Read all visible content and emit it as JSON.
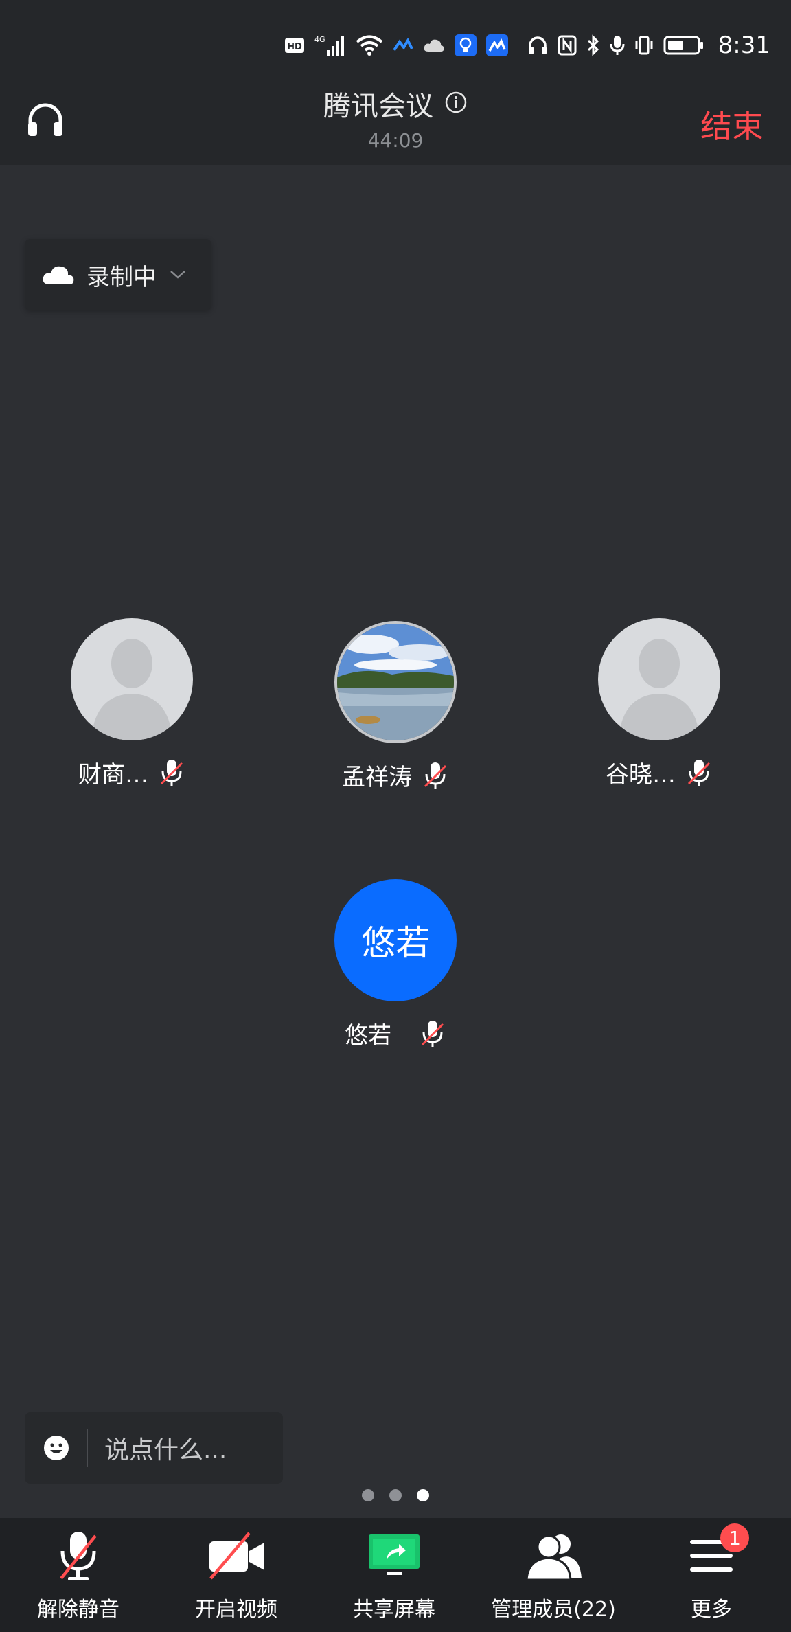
{
  "status_bar": {
    "icons": [
      "hd-icon",
      "4g-signal-icon",
      "wifi-icon",
      "app-icon",
      "cloud-icon",
      "bulb-icon",
      "app-icon",
      "headphone-icon",
      "nfc-icon",
      "bluetooth-icon",
      "mic-icon",
      "vibrate-icon",
      "battery-icon"
    ],
    "time": "8:31"
  },
  "header": {
    "title": "腾讯会议",
    "timer": "44:09",
    "end_label": "结束",
    "end_color": "#ff4a4f"
  },
  "recording": {
    "label": "录制中"
  },
  "participants": [
    {
      "name": "财商…",
      "avatar": "default",
      "muted": true
    },
    {
      "name": "孟祥涛",
      "avatar": "photo",
      "muted": true
    },
    {
      "name": "谷晓…",
      "avatar": "default",
      "muted": true
    },
    {
      "name": "悠若",
      "avatar": "text",
      "avatar_text": "悠若",
      "avatar_color": "#0a6cff",
      "muted": true
    }
  ],
  "chat": {
    "placeholder": "说点什么..."
  },
  "pager": {
    "total": 3,
    "active": 3
  },
  "toolbar": {
    "items": [
      {
        "label": "解除静音",
        "icon": "mic-muted-icon"
      },
      {
        "label": "开启视频",
        "icon": "video-off-icon"
      },
      {
        "label": "共享屏幕",
        "icon": "share-screen-icon"
      },
      {
        "label": "管理成员(22)",
        "icon": "members-icon"
      },
      {
        "label": "更多",
        "icon": "menu-icon",
        "badge": "1"
      }
    ]
  }
}
